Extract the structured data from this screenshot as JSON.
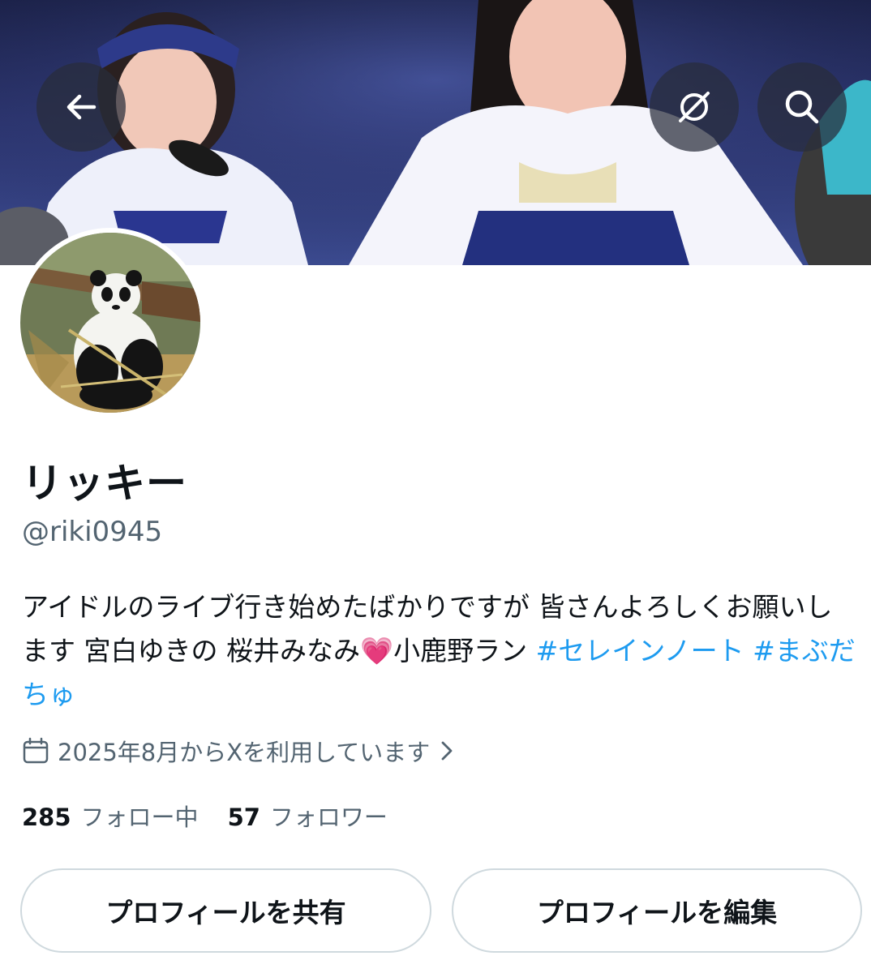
{
  "header": {
    "back_icon": "arrow-left-icon",
    "grok_icon": "grok-icon",
    "search_icon": "search-icon"
  },
  "profile": {
    "display_name": "リッキー",
    "handle": "@riki0945",
    "bio": {
      "text_1": "アイドルのライブ行き始めたばかりですが 皆さんよろしくお願いします 宮白ゆきの 桜井みなみ",
      "emoji": "💗",
      "text_2": "小鹿野ラン ",
      "hashtag_1": "#セレインノート",
      "hashtag_2": "#まぶだちゅ"
    },
    "joined": "2025年8月からXを利用しています",
    "following_count": "285",
    "following_label": "フォロー中",
    "followers_count": "57",
    "followers_label": "フォロワー"
  },
  "buttons": {
    "share": "プロフィールを共有",
    "edit": "プロフィールを編集"
  },
  "colors": {
    "accent": "#1d9bf0",
    "secondary_text": "#536471",
    "primary_text": "#0f1419",
    "button_border": "#cfd9de"
  }
}
